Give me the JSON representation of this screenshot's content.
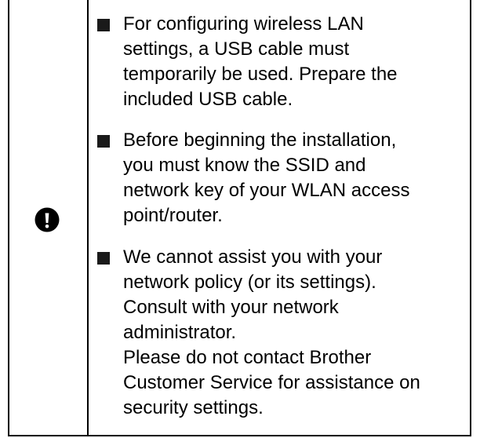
{
  "notice": {
    "icon": "exclamation-circle-icon",
    "items": [
      {
        "lines": [
          "For configuring wireless LAN",
          "settings, a USB cable must",
          "temporarily be used. Prepare the",
          "included USB cable."
        ]
      },
      {
        "lines": [
          "Before beginning the installation,",
          "you must know the SSID and",
          "network key of your WLAN access",
          "point/router."
        ]
      },
      {
        "lines": [
          "We cannot assist you with your",
          "network policy (or its settings).",
          "Consult with your network",
          "administrator.",
          "Please do not contact Brother",
          "Customer Service for assistance on",
          "security settings."
        ]
      }
    ]
  }
}
